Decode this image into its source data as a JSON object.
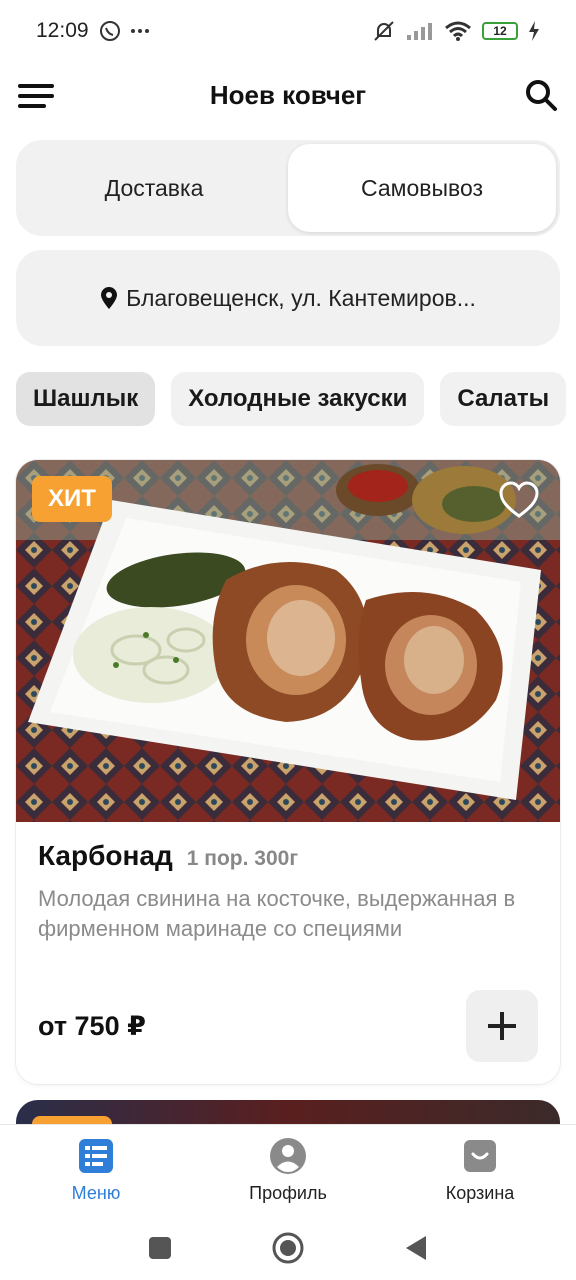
{
  "status_bar": {
    "time": "12:09",
    "battery": "12",
    "icons": [
      "viber-icon",
      "more-dots-icon",
      "mute-bell-icon",
      "signal-icon",
      "wifi-icon",
      "battery-icon",
      "charging-icon"
    ]
  },
  "header": {
    "title": "Ноев ковчег",
    "menu_icon": "hamburger-icon",
    "search_icon": "search-icon"
  },
  "delivery": {
    "options": [
      "Доставка",
      "Самовывоз"
    ],
    "selected": "Самовывоз"
  },
  "address": {
    "text": "Благовещенск, ул. Кантемиров...",
    "icon": "location-pin-icon"
  },
  "categories": {
    "items": [
      "Шашлык",
      "Холодные закуски",
      "Салаты"
    ],
    "selected": "Шашлык"
  },
  "product": {
    "badge": "ХИТ",
    "name": "Карбонад",
    "portion": "1 пор. 300г",
    "description": "Молодая свинина на косточке, выдержанная в фирменном маринаде со специями",
    "price": "от 750 ₽",
    "favorite_icon": "heart-outline-icon",
    "add_icon": "plus-icon"
  },
  "bottom_nav": {
    "items": [
      {
        "label": "Меню",
        "icon": "menu-list-icon",
        "active": true
      },
      {
        "label": "Профиль",
        "icon": "profile-icon",
        "active": false
      },
      {
        "label": "Корзина",
        "icon": "cart-bag-icon",
        "active": false
      }
    ]
  },
  "colors": {
    "accent": "#2f7ed8",
    "badge": "#f7a133",
    "chip_bg": "#f1f1f1",
    "muted_text": "#8b8b8b"
  }
}
